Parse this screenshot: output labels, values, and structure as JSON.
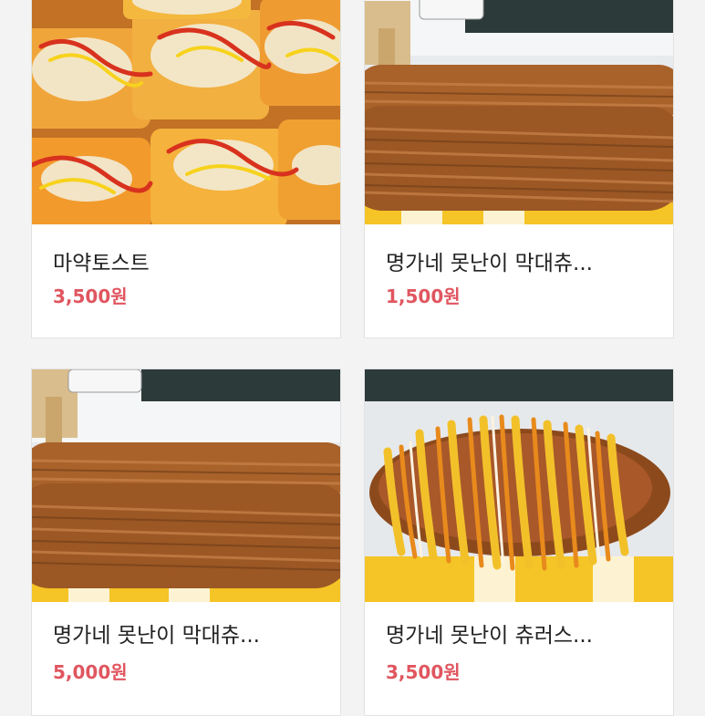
{
  "products": [
    {
      "name": "마약토스트",
      "price": "3,500원"
    },
    {
      "name": "명가네 못난이 막대츄...",
      "price": "1,500원"
    },
    {
      "name": "명가네 못난이 막대츄...",
      "price": "5,000원"
    },
    {
      "name": "명가네 못난이 츄러스...",
      "price": "3,500원"
    }
  ],
  "colors": {
    "price": "#e0565f",
    "card_bg": "#ffffff",
    "page_bg": "#f3f3f3"
  }
}
